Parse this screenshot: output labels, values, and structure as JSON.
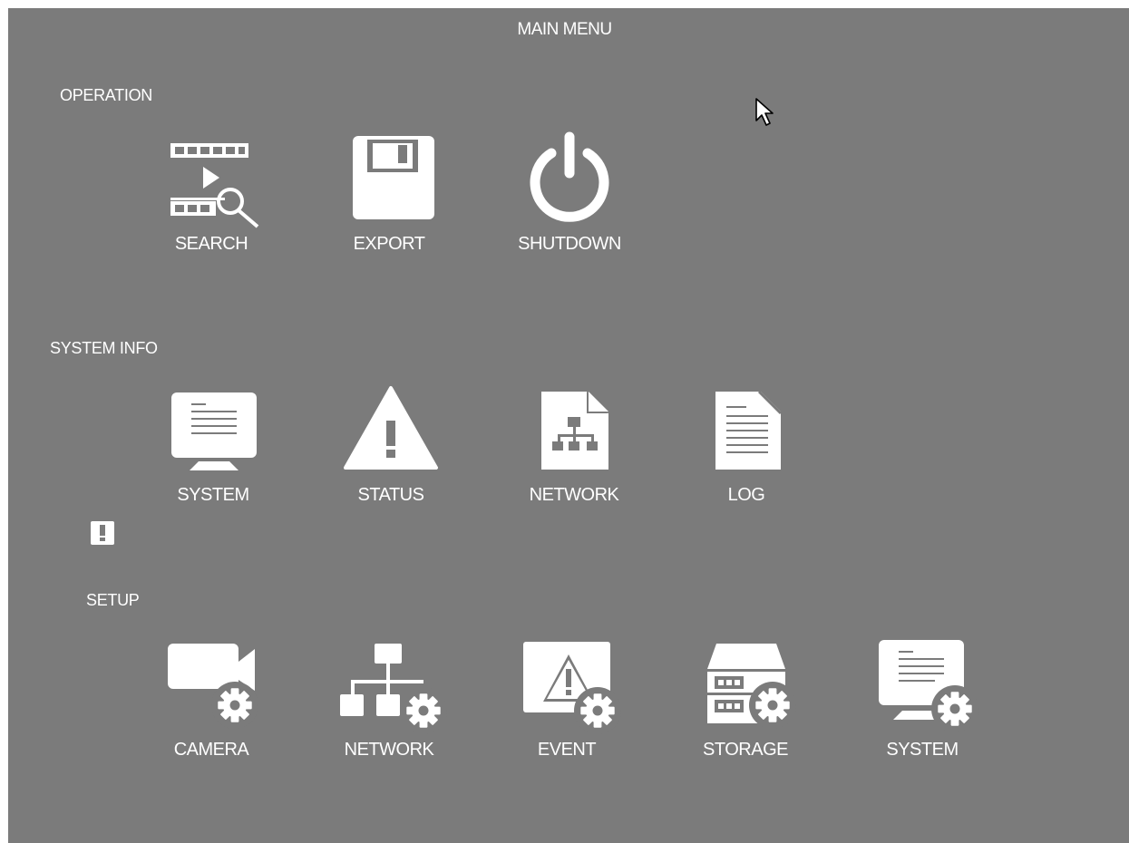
{
  "title": "MAIN MENU",
  "sections": {
    "operation": {
      "label": "OPERATION",
      "items": [
        {
          "label": "SEARCH",
          "icon": "video-search-icon"
        },
        {
          "label": "EXPORT",
          "icon": "floppy-disk-icon"
        },
        {
          "label": "SHUTDOWN",
          "icon": "power-icon"
        }
      ]
    },
    "system_info": {
      "label": "SYSTEM INFO",
      "items": [
        {
          "label": "SYSTEM",
          "icon": "monitor-icon"
        },
        {
          "label": "STATUS",
          "icon": "warning-triangle-icon"
        },
        {
          "label": "NETWORK",
          "icon": "network-document-icon"
        },
        {
          "label": "LOG",
          "icon": "log-document-icon"
        }
      ]
    },
    "setup": {
      "label": "SETUP",
      "items": [
        {
          "label": "CAMERA",
          "icon": "camera-gear-icon"
        },
        {
          "label": "NETWORK",
          "icon": "network-gear-icon"
        },
        {
          "label": "EVENT",
          "icon": "event-gear-icon"
        },
        {
          "label": "STORAGE",
          "icon": "storage-gear-icon"
        },
        {
          "label": "SYSTEM",
          "icon": "monitor-gear-icon"
        }
      ]
    }
  },
  "colors": {
    "background": "#7b7b7b",
    "foreground": "#ffffff"
  }
}
